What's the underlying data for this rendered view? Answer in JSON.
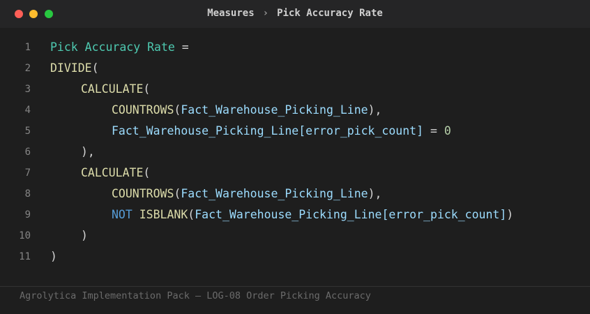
{
  "titlebar": {
    "window_controls": [
      "close",
      "minimize",
      "maximize"
    ],
    "breadcrumb": {
      "section": "Measures",
      "separator": "›",
      "current": "Pick Accuracy Rate"
    }
  },
  "editor": {
    "lines": [
      {
        "number": "1",
        "indent": 0,
        "tokens": [
          {
            "type": "measure",
            "text": "Pick Accuracy Rate"
          },
          {
            "type": "punc",
            "text": " ="
          }
        ]
      },
      {
        "number": "2",
        "indent": 0,
        "tokens": [
          {
            "type": "fn",
            "text": "DIVIDE"
          },
          {
            "type": "punc",
            "text": "("
          }
        ]
      },
      {
        "number": "3",
        "indent": 1,
        "tokens": [
          {
            "type": "fn",
            "text": "CALCULATE"
          },
          {
            "type": "punc",
            "text": "("
          }
        ]
      },
      {
        "number": "4",
        "indent": 2,
        "tokens": [
          {
            "type": "fn",
            "text": "COUNTROWS"
          },
          {
            "type": "punc",
            "text": "("
          },
          {
            "type": "table",
            "text": "Fact_Warehouse_Picking_Line"
          },
          {
            "type": "punc",
            "text": "),"
          }
        ]
      },
      {
        "number": "5",
        "indent": 2,
        "tokens": [
          {
            "type": "table",
            "text": "Fact_Warehouse_Picking_Line[error_pick_count]"
          },
          {
            "type": "punc",
            "text": " = "
          },
          {
            "type": "num",
            "text": "0"
          }
        ]
      },
      {
        "number": "6",
        "indent": 1,
        "tokens": [
          {
            "type": "punc",
            "text": "),"
          }
        ]
      },
      {
        "number": "7",
        "indent": 1,
        "tokens": [
          {
            "type": "fn",
            "text": "CALCULATE"
          },
          {
            "type": "punc",
            "text": "("
          }
        ]
      },
      {
        "number": "8",
        "indent": 2,
        "tokens": [
          {
            "type": "fn",
            "text": "COUNTROWS"
          },
          {
            "type": "punc",
            "text": "("
          },
          {
            "type": "table",
            "text": "Fact_Warehouse_Picking_Line"
          },
          {
            "type": "punc",
            "text": "),"
          }
        ]
      },
      {
        "number": "9",
        "indent": 2,
        "tokens": [
          {
            "type": "kw",
            "text": "NOT"
          },
          {
            "type": "punc",
            "text": " "
          },
          {
            "type": "fn",
            "text": "ISBLANK"
          },
          {
            "type": "punc",
            "text": "("
          },
          {
            "type": "table",
            "text": "Fact_Warehouse_Picking_Line[error_pick_count]"
          },
          {
            "type": "punc",
            "text": ")"
          }
        ]
      },
      {
        "number": "10",
        "indent": 1,
        "tokens": [
          {
            "type": "punc",
            "text": ")"
          }
        ]
      },
      {
        "number": "11",
        "indent": 0,
        "tokens": [
          {
            "type": "punc",
            "text": ")"
          }
        ]
      }
    ]
  },
  "footer": {
    "text": "Agrolytica Implementation Pack — LOG-08 Order Picking Accuracy"
  },
  "colors": {
    "background": "#1e1e1e",
    "titlebar": "#252526",
    "measure": "#4ec9b0",
    "function": "#dcdcaa",
    "table": "#9cdcfe",
    "keyword": "#569cd6",
    "number": "#b5cea8"
  }
}
